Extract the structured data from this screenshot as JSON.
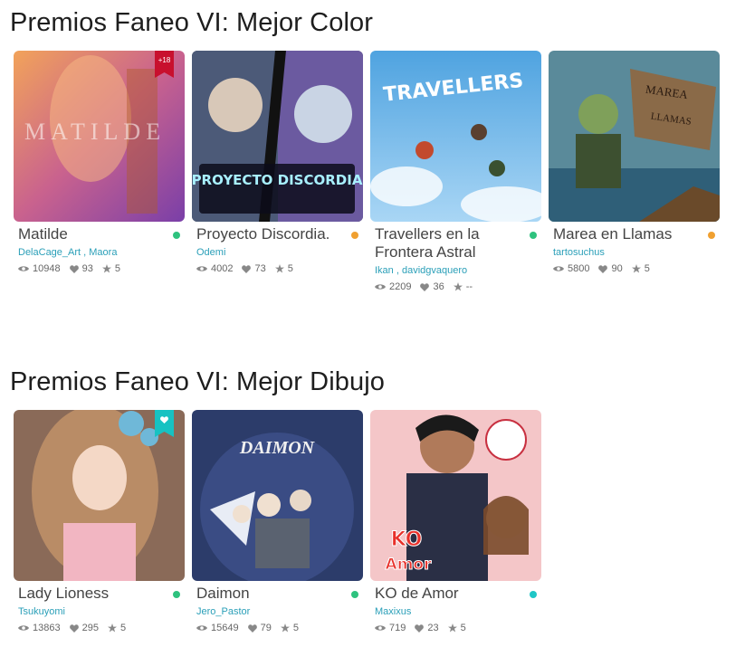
{
  "sections": [
    {
      "title": "Premios Faneo VI: Mejor Color",
      "cards": [
        {
          "title": "Matilde",
          "authors": [
            "DelaCage_Art",
            "Maora"
          ],
          "views": "10948",
          "likes": "93",
          "rating": "5",
          "status_color": "#2ec27e",
          "badge": "+18",
          "cover_text": "MATILDE"
        },
        {
          "title": "Proyecto Discordia.",
          "authors": [
            "Odemi"
          ],
          "views": "4002",
          "likes": "73",
          "rating": "5",
          "status_color": "#f0a030",
          "cover_text": "PROYECTO DISCORDIA"
        },
        {
          "title": "Travellers en la Frontera Astral",
          "authors": [
            "Ikan",
            "davidgvaquero"
          ],
          "views": "2209",
          "likes": "36",
          "rating": "--",
          "status_color": "#2ec27e",
          "cover_text": "TRAVELLERS"
        },
        {
          "title": "Marea en Llamas",
          "authors": [
            "tartosuchus"
          ],
          "views": "5800",
          "likes": "90",
          "rating": "5",
          "status_color": "#f0a030",
          "cover_text": "MAREA EN LLAMAS"
        }
      ]
    },
    {
      "title": "Premios Faneo VI: Mejor Dibujo",
      "cards": [
        {
          "title": "Lady Lioness",
          "authors": [
            "Tsukuyomi"
          ],
          "views": "13863",
          "likes": "295",
          "rating": "5",
          "status_color": "#2ec27e",
          "badge": "heart"
        },
        {
          "title": "Daimon",
          "authors": [
            "Jero_Pastor"
          ],
          "views": "15649",
          "likes": "79",
          "rating": "5",
          "status_color": "#2ec27e",
          "cover_text": "DAIMON"
        },
        {
          "title": "KO de Amor",
          "authors": [
            "Maxixus"
          ],
          "views": "719",
          "likes": "23",
          "rating": "5",
          "status_color": "#1fc6c6",
          "cover_text": "KO DE AMOR"
        }
      ]
    }
  ],
  "icons": {
    "views": "eye-icon",
    "likes": "heart-icon",
    "rating": "star-icon"
  }
}
